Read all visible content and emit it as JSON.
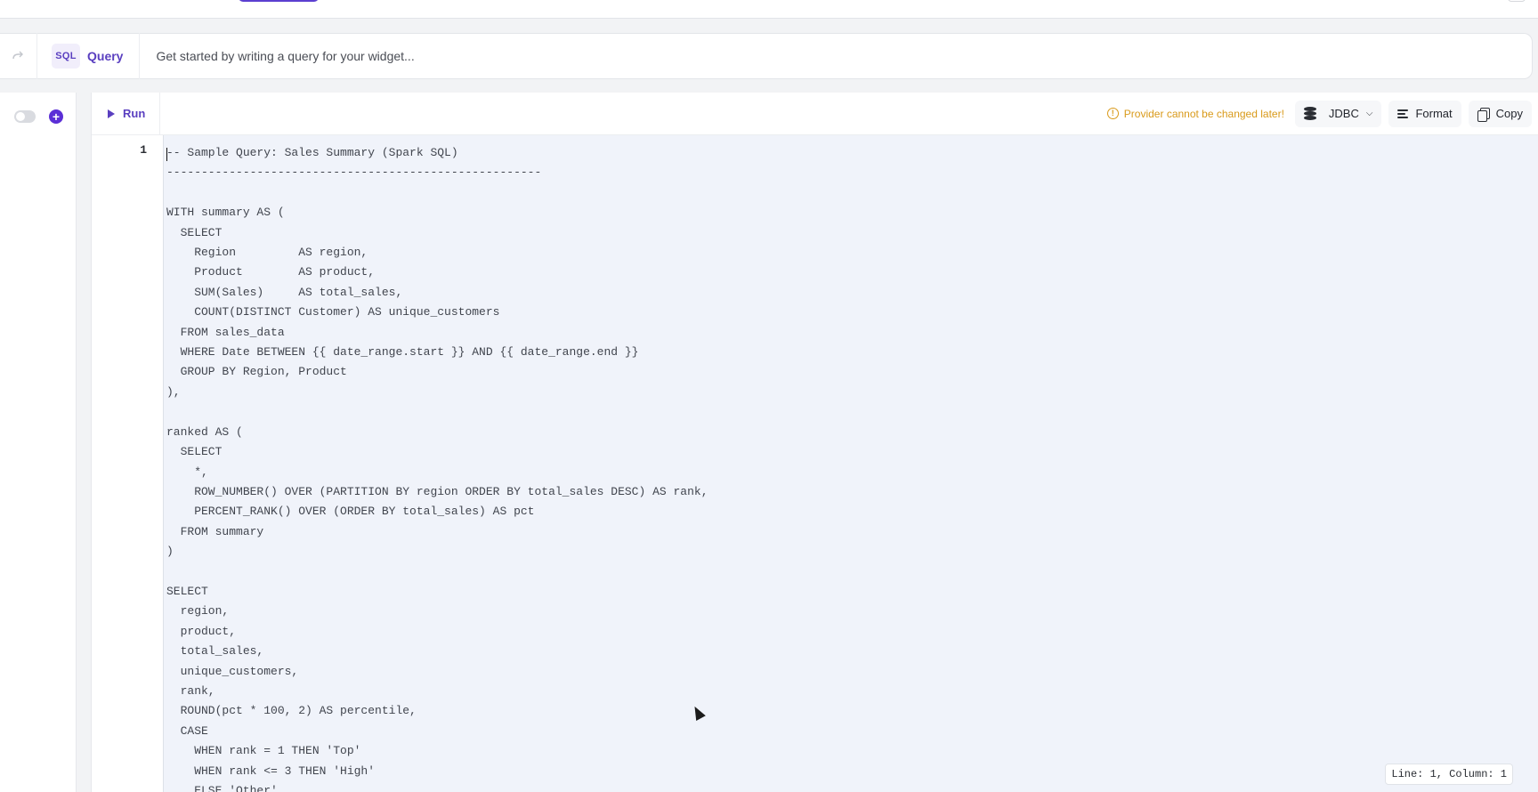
{
  "query_bar": {
    "badge": "SQL",
    "tab_label": "Query",
    "placeholder": "Get started by writing a query for your widget..."
  },
  "toolbar": {
    "run_label": "Run",
    "warning": "Provider cannot be changed later!",
    "provider": "JDBC",
    "format_label": "Format",
    "copy_label": "Copy"
  },
  "editor": {
    "line_number": "1",
    "code": "-- Sample Query: Sales Summary (Spark SQL)\n------------------------------------------------------\n\nWITH summary AS (\n  SELECT\n    Region         AS region,\n    Product        AS product,\n    SUM(Sales)     AS total_sales,\n    COUNT(DISTINCT Customer) AS unique_customers\n  FROM sales_data\n  WHERE Date BETWEEN {{ date_range.start }} AND {{ date_range.end }}\n  GROUP BY Region, Product\n),\n\nranked AS (\n  SELECT\n    *,\n    ROW_NUMBER() OVER (PARTITION BY region ORDER BY total_sales DESC) AS rank,\n    PERCENT_RANK() OVER (ORDER BY total_sales) AS pct\n  FROM summary\n)\n\nSELECT\n  region,\n  product,\n  total_sales,\n  unique_customers,\n  rank,\n  ROUND(pct * 100, 2) AS percentile,\n  CASE\n    WHEN rank = 1 THEN 'Top'\n    WHEN rank <= 3 THEN 'High'\n    ELSE 'Other'",
    "status": "Line: 1, Column: 1"
  },
  "colors": {
    "accent": "#5a3fc0",
    "warning": "#d99a1a",
    "code_background": "#f0f3fa"
  },
  "icons": {
    "redo": "redo-icon",
    "play": "play-icon",
    "warning": "warning-circle-icon",
    "provider": "database-icon",
    "format": "format-lines-icon",
    "copy": "copy-icon"
  }
}
